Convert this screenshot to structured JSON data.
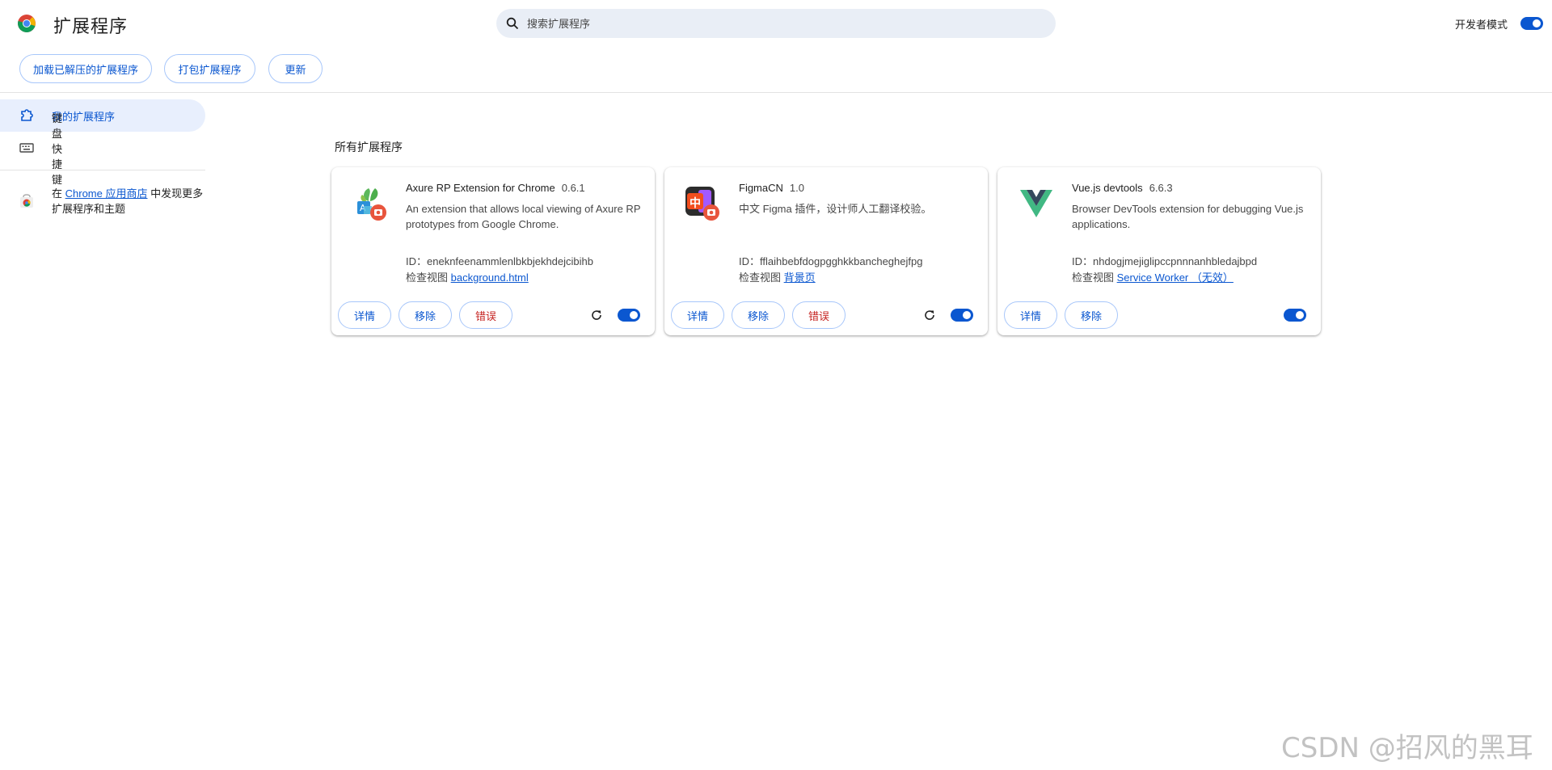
{
  "header": {
    "title": "扩展程序",
    "search_placeholder": "搜索扩展程序",
    "dev_mode_label": "开发者模式",
    "dev_mode_on": true
  },
  "toolbar": {
    "load_unpacked": "加载已解压的扩展程序",
    "pack": "打包扩展程序",
    "update": "更新"
  },
  "sidebar": {
    "items": [
      {
        "label": "我的扩展程序",
        "icon": "puzzle-icon",
        "active": true
      },
      {
        "label": "键盘快捷键",
        "icon": "keyboard-icon",
        "active": false
      }
    ],
    "store_prefix": "在 ",
    "store_link": "Chrome 应用商店",
    "store_suffix": " 中发现更多扩展程序和主题"
  },
  "section_title": "所有扩展程序",
  "extensions": [
    {
      "name": "Axure RP Extension for Chrome",
      "version": "0.6.1",
      "description": "An extension that allows local viewing of Axure RP prototypes from Google Chrome.",
      "id_label": "ID：",
      "id": "eneknfeenammlenlbkbjekhdejcibihb",
      "inspect_label": "检查视图",
      "inspect_link": "background.html",
      "details": "详情",
      "remove": "移除",
      "errors": "错误",
      "enabled": true
    },
    {
      "name": "FigmaCN",
      "version": "1.0",
      "description": "中文 Figma 插件，设计师人工翻译校验。",
      "id_label": "ID：",
      "id": "fflaihbebfdogpgghkkbancheghejfpg",
      "inspect_label": "检查视图",
      "inspect_link": "背景页",
      "icon_text": "中",
      "details": "详情",
      "remove": "移除",
      "errors": "错误",
      "enabled": true
    },
    {
      "name": "Vue.js devtools",
      "version": "6.6.3",
      "description": "Browser DevTools extension for debugging Vue.js applications.",
      "id_label": "ID：",
      "id": "nhdogjmejiglipccpnnnanhbledajbpd",
      "inspect_label": "检查视图",
      "inspect_link": "Service Worker （无效）",
      "details": "详情",
      "remove": "移除",
      "enabled": true
    }
  ],
  "colors": {
    "accent": "#0b57d0",
    "error": "#c5221f",
    "search_bg": "#e9eef6",
    "sidebar_active_bg": "#e8effd"
  },
  "watermark": "CSDN @招风的黑耳"
}
